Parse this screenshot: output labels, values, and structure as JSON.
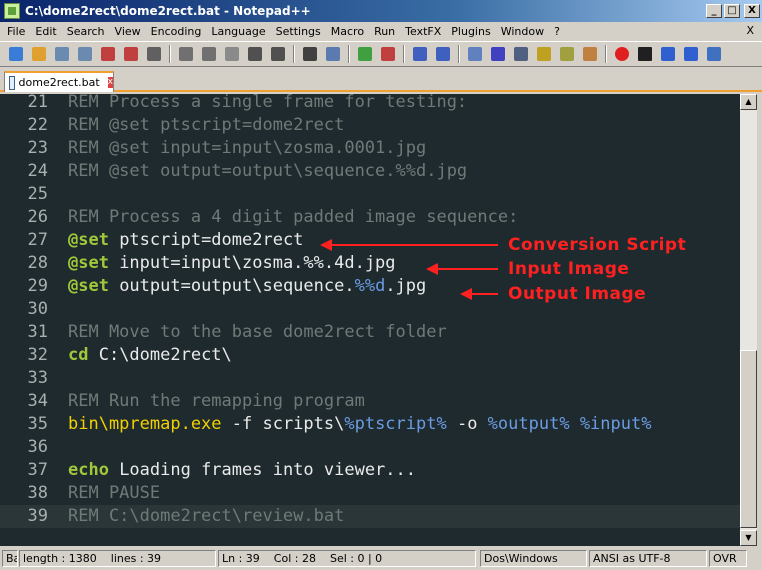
{
  "window": {
    "title": "C:\\dome2rect\\dome2rect.bat - Notepad++",
    "minimize": "_",
    "maximize": "□",
    "close": "X"
  },
  "menu": [
    "File",
    "Edit",
    "Search",
    "View",
    "Encoding",
    "Language",
    "Settings",
    "Macro",
    "Run",
    "TextFX",
    "Plugins",
    "Window",
    "?"
  ],
  "menu_close": "X",
  "tab": {
    "label": "dome2rect.bat",
    "close": "x"
  },
  "lines": [
    {
      "n": "21",
      "parts": [
        {
          "t": "REM Process a single frame for testing:",
          "c": "rem"
        }
      ]
    },
    {
      "n": "22",
      "parts": [
        {
          "t": "REM @set ptscript=dome2rect",
          "c": "rem"
        }
      ]
    },
    {
      "n": "23",
      "parts": [
        {
          "t": "REM @set input=input\\zosma.0001.jpg",
          "c": "rem"
        }
      ]
    },
    {
      "n": "24",
      "parts": [
        {
          "t": "REM @set output=output\\sequence.%%d.jpg",
          "c": "rem"
        }
      ]
    },
    {
      "n": "25",
      "parts": []
    },
    {
      "n": "26",
      "parts": [
        {
          "t": "REM Process a 4 digit padded image sequence:",
          "c": "rem"
        }
      ]
    },
    {
      "n": "27",
      "parts": [
        {
          "t": "@set",
          "c": "kw"
        },
        {
          "t": " ptscript=dome2rect",
          "c": "txt"
        }
      ]
    },
    {
      "n": "28",
      "parts": [
        {
          "t": "@set",
          "c": "kw"
        },
        {
          "t": " input=input\\zosma.%%.4d.jpg",
          "c": "txt"
        }
      ]
    },
    {
      "n": "29",
      "parts": [
        {
          "t": "@set",
          "c": "kw"
        },
        {
          "t": " output=output\\sequence.",
          "c": "txt"
        },
        {
          "t": "%%d",
          "c": "var"
        },
        {
          "t": ".jpg",
          "c": "txt"
        }
      ]
    },
    {
      "n": "30",
      "parts": []
    },
    {
      "n": "31",
      "parts": [
        {
          "t": "REM Move to the base dome2rect folder",
          "c": "rem"
        }
      ]
    },
    {
      "n": "32",
      "parts": [
        {
          "t": "cd",
          "c": "kw"
        },
        {
          "t": " C:\\dome2rect\\",
          "c": "txt"
        }
      ]
    },
    {
      "n": "33",
      "parts": []
    },
    {
      "n": "34",
      "parts": [
        {
          "t": "REM Run the remapping program",
          "c": "rem"
        }
      ]
    },
    {
      "n": "35",
      "parts": [
        {
          "t": "bin\\mpremap.exe",
          "c": "exe"
        },
        {
          "t": " -f scripts\\",
          "c": "txt"
        },
        {
          "t": "%ptscript%",
          "c": "var"
        },
        {
          "t": " -o ",
          "c": "txt"
        },
        {
          "t": "%output%",
          "c": "var"
        },
        {
          "t": " ",
          "c": "txt"
        },
        {
          "t": "%input%",
          "c": "var"
        }
      ]
    },
    {
      "n": "36",
      "parts": []
    },
    {
      "n": "37",
      "parts": [
        {
          "t": "echo",
          "c": "kw"
        },
        {
          "t": " Loading frames into viewer...",
          "c": "txt"
        }
      ]
    },
    {
      "n": "38",
      "parts": [
        {
          "t": "REM PAUSE",
          "c": "rem"
        }
      ]
    },
    {
      "n": "39",
      "parts": [
        {
          "t": "REM C:\\dome2rect\\review.bat",
          "c": "rem"
        }
      ]
    }
  ],
  "current_line": "39",
  "annotations": [
    "Conversion Script",
    "Input Image",
    "Output Image"
  ],
  "annotation_color": "#ff2020",
  "status": {
    "type": "Ba",
    "length": "length : 1380",
    "lines": "lines : 39",
    "ln": "Ln : 39",
    "col": "Col : 28",
    "sel": "Sel : 0 | 0",
    "eol": "Dos\\Windows",
    "encoding": "ANSI as UTF-8",
    "mode": "OVR"
  },
  "toolbar_icons": [
    "new-file-icon",
    "open-file-icon",
    "save-icon",
    "save-all-icon",
    "close-icon",
    "close-all-icon",
    "print-icon",
    "cut-icon",
    "copy-icon",
    "paste-icon",
    "undo-icon",
    "redo-icon",
    "find-icon",
    "replace-icon",
    "zoom-in-icon",
    "zoom-out-icon",
    "sync-v-icon",
    "sync-h-icon",
    "wrap-icon",
    "all-chars-icon",
    "indent-guide-icon",
    "user-lang-icon",
    "doc-map-icon",
    "function-list-icon",
    "record-macro-icon",
    "stop-record-icon",
    "play-macro-icon",
    "run-multiple-icon",
    "save-macro-icon"
  ],
  "colors": {
    "editor_bg": "#1e2a2e",
    "rem": "#6f7a78",
    "keyword": "#a0c83a",
    "text": "#eaeaea",
    "variable": "#6b9be0",
    "exe": "#f0d000",
    "tab_accent": "#f0a030"
  }
}
